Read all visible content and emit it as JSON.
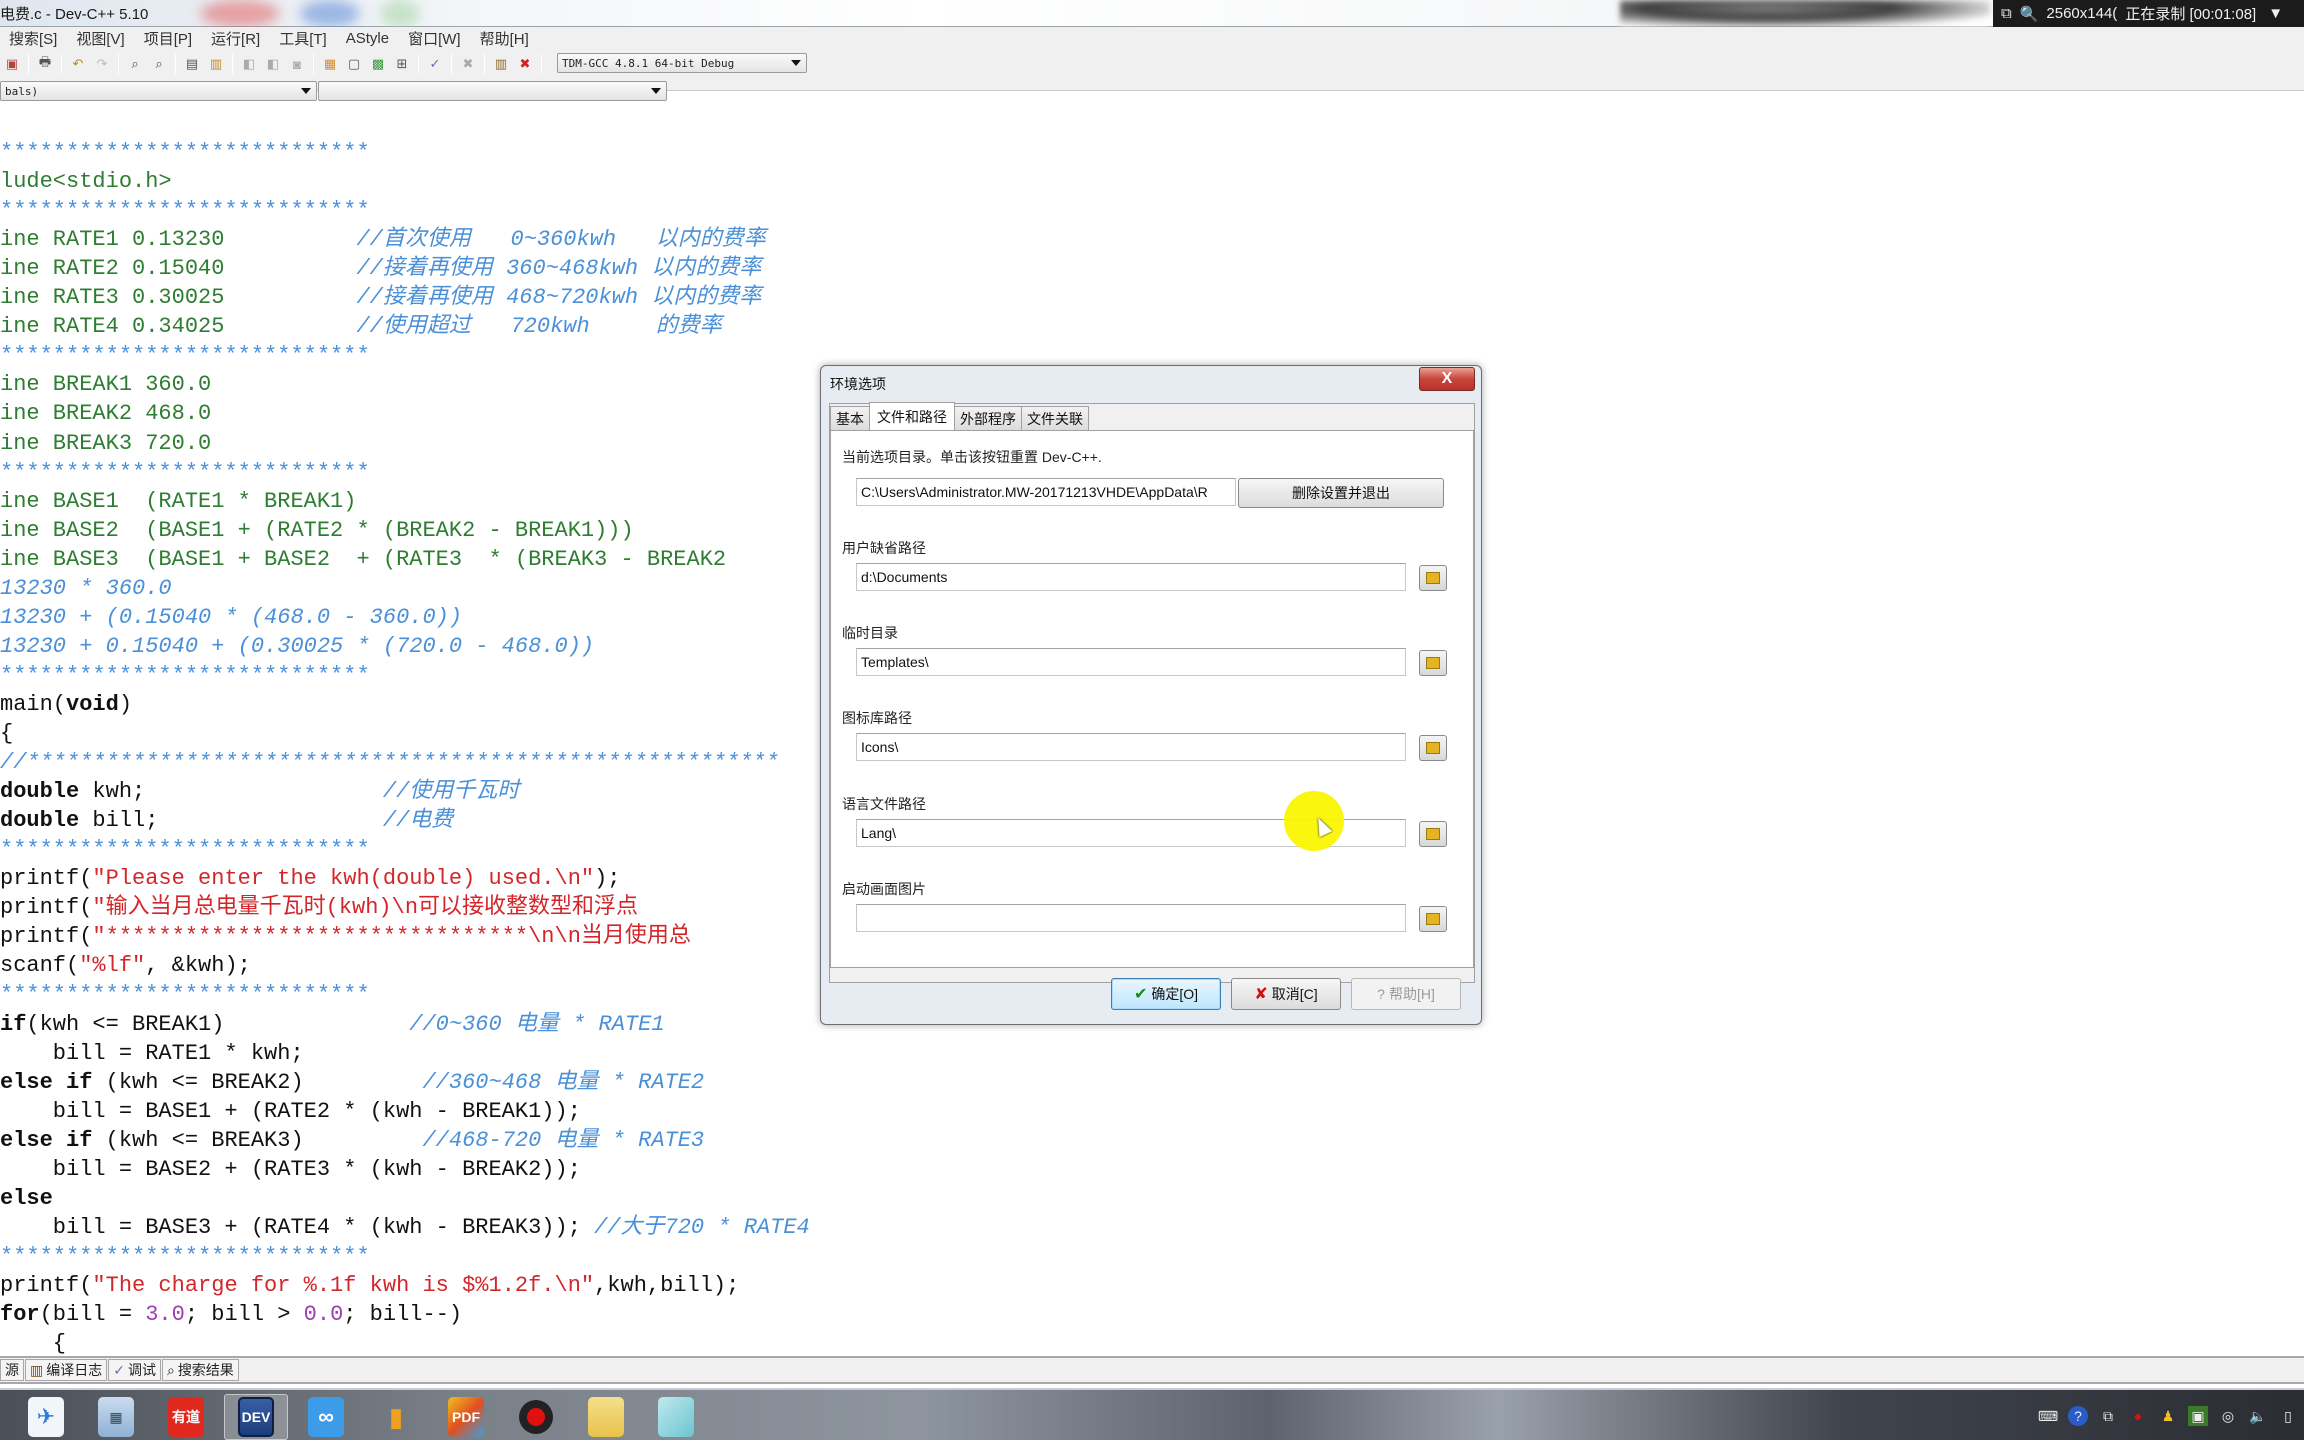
{
  "window": {
    "title": "电费.c - Dev-C++ 5.10"
  },
  "recorder": {
    "resolution": "2560x144(",
    "status": "正在录制 [00:01:08]"
  },
  "menu": [
    {
      "label": "搜索[S]"
    },
    {
      "label": "视图[V]"
    },
    {
      "label": "项目[P]"
    },
    {
      "label": "运行[R]"
    },
    {
      "label": "工具[T]"
    },
    {
      "label": "AStyle"
    },
    {
      "label": "窗口[W]"
    },
    {
      "label": "帮助[H]"
    }
  ],
  "toolbar": {
    "compiler_select": "TDM-GCC 4.8.1 64-bit Debug",
    "scope_select": "bals)",
    "symbol_select": "",
    "icons": [
      "close-file-icon",
      "print-icon",
      "undo-icon",
      "redo-icon",
      "find-icon",
      "replace-icon",
      "indent-icon",
      "unindent-icon",
      "bookmark-icon",
      "goto-icon",
      "toggle-icon",
      "new-project-icon",
      "window-icon",
      "class-icon",
      "grid-icon",
      "check-icon",
      "delete-icon",
      "chart-icon",
      "debug-icon"
    ]
  },
  "code_lines": [
    {
      "segments": [
        {
          "text": "****************************",
          "cls": "c-blue"
        }
      ]
    },
    {
      "segments": [
        {
          "text": "lude<stdio.h>",
          "cls": "c-green"
        }
      ]
    },
    {
      "segments": [
        {
          "text": "****************************",
          "cls": "c-blue"
        }
      ]
    },
    {
      "segments": [
        {
          "text": "ine RATE1 0.13230          ",
          "cls": "c-green"
        },
        {
          "text": "//首次使用   0~360kwh   以内的费率",
          "cls": "c-blue-i"
        }
      ]
    },
    {
      "segments": [
        {
          "text": "ine RATE2 0.15040          ",
          "cls": "c-green"
        },
        {
          "text": "//接着再使用 360~468kwh 以内的费率",
          "cls": "c-blue-i"
        }
      ]
    },
    {
      "segments": [
        {
          "text": "ine RATE3 0.30025          ",
          "cls": "c-green"
        },
        {
          "text": "//接着再使用 468~720kwh 以内的费率",
          "cls": "c-blue-i"
        }
      ]
    },
    {
      "segments": [
        {
          "text": "ine RATE4 0.34025          ",
          "cls": "c-green"
        },
        {
          "text": "//使用超过   720kwh     的费率",
          "cls": "c-blue-i"
        }
      ]
    },
    {
      "segments": [
        {
          "text": "****************************",
          "cls": "c-blue"
        }
      ]
    },
    {
      "segments": [
        {
          "text": "ine BREAK1 360.0",
          "cls": "c-green"
        }
      ]
    },
    {
      "segments": [
        {
          "text": "ine BREAK2 468.0",
          "cls": "c-green"
        }
      ]
    },
    {
      "segments": [
        {
          "text": "ine BREAK3 720.0",
          "cls": "c-green"
        }
      ]
    },
    {
      "segments": [
        {
          "text": "****************************",
          "cls": "c-blue"
        }
      ]
    },
    {
      "segments": [
        {
          "text": "ine BASE1  (RATE1 * BREAK1)",
          "cls": "c-green"
        }
      ]
    },
    {
      "segments": [
        {
          "text": "ine BASE2  (BASE1 + (RATE2 * (BREAK2 - BREAK1)))",
          "cls": "c-green"
        }
      ]
    },
    {
      "segments": [
        {
          "text": "ine BASE3  (BASE1 + BASE2  + (RATE3  * (BREAK3 - BREAK2",
          "cls": "c-green"
        }
      ]
    },
    {
      "segments": [
        {
          "text": "13230 * 360.0",
          "cls": "c-blue-i"
        }
      ]
    },
    {
      "segments": [
        {
          "text": "13230 + (0.15040 * (468.0 - 360.0))",
          "cls": "c-blue-i"
        }
      ]
    },
    {
      "segments": [
        {
          "text": "13230 + 0.15040 + (0.30025 * (720.0 - 468.0))",
          "cls": "c-blue-i"
        }
      ]
    },
    {
      "segments": [
        {
          "text": "****************************",
          "cls": "c-blue"
        }
      ]
    },
    {
      "segments": [
        {
          "text": "main(",
          "cls": "c-black"
        },
        {
          "text": "void",
          "cls": "c-bold"
        },
        {
          "text": ")",
          "cls": "c-black"
        }
      ]
    },
    {
      "segments": [
        {
          "text": "{",
          "cls": "c-black"
        }
      ]
    },
    {
      "segments": [
        {
          "text": "//*********************************************************",
          "cls": "c-blue-i"
        }
      ]
    },
    {
      "segments": [
        {
          "text": "double",
          "cls": "c-bold"
        },
        {
          "text": " kwh;                  ",
          "cls": "c-black"
        },
        {
          "text": "//使用千瓦时",
          "cls": "c-blue-i"
        }
      ]
    },
    {
      "segments": [
        {
          "text": "double",
          "cls": "c-bold"
        },
        {
          "text": " bill;                 ",
          "cls": "c-black"
        },
        {
          "text": "//电费",
          "cls": "c-blue-i"
        }
      ]
    },
    {
      "segments": [
        {
          "text": "****************************",
          "cls": "c-blue"
        }
      ]
    },
    {
      "segments": [
        {
          "text": "printf(",
          "cls": "c-black"
        },
        {
          "text": "\"Please enter the kwh(double) used.\\n\"",
          "cls": "c-red"
        },
        {
          "text": ");",
          "cls": "c-black"
        }
      ]
    },
    {
      "segments": [
        {
          "text": "printf(",
          "cls": "c-black"
        },
        {
          "text": "\"输入当月总电量千瓦时(kwh)\\n可以接收整数型和浮点",
          "cls": "c-red"
        }
      ]
    },
    {
      "segments": [
        {
          "text": "printf(",
          "cls": "c-black"
        },
        {
          "text": "\"********************************\\n\\n当月使用总",
          "cls": "c-red"
        }
      ]
    },
    {
      "segments": [
        {
          "text": "scanf(",
          "cls": "c-black"
        },
        {
          "text": "\"%lf\"",
          "cls": "c-red"
        },
        {
          "text": ", &kwh);",
          "cls": "c-black"
        }
      ]
    },
    {
      "segments": [
        {
          "text": "****************************",
          "cls": "c-blue"
        }
      ]
    },
    {
      "segments": [
        {
          "text": "if",
          "cls": "c-bold"
        },
        {
          "text": "(kwh <= BREAK1)              ",
          "cls": "c-black"
        },
        {
          "text": "//0~360 电量 * RATE1",
          "cls": "c-blue-i"
        }
      ]
    },
    {
      "segments": [
        {
          "text": "    bill = RATE1 * kwh;",
          "cls": "c-black"
        }
      ]
    },
    {
      "segments": [
        {
          "text": "else if",
          "cls": "c-bold"
        },
        {
          "text": " (kwh <= BREAK2)         ",
          "cls": "c-black"
        },
        {
          "text": "//360~468 电量 * RATE2",
          "cls": "c-blue-i"
        }
      ]
    },
    {
      "segments": [
        {
          "text": "    bill = BASE1 + (RATE2 * (kwh - BREAK1));",
          "cls": "c-black"
        }
      ]
    },
    {
      "segments": [
        {
          "text": "else if",
          "cls": "c-bold"
        },
        {
          "text": " (kwh <= BREAK3)         ",
          "cls": "c-black"
        },
        {
          "text": "//468-720 电量 * RATE3",
          "cls": "c-blue-i"
        }
      ]
    },
    {
      "segments": [
        {
          "text": "    bill = BASE2 + (RATE3 * (kwh - BREAK2));",
          "cls": "c-black"
        }
      ]
    },
    {
      "segments": [
        {
          "text": "else",
          "cls": "c-bold"
        }
      ]
    },
    {
      "segments": [
        {
          "text": "    bill = BASE3 + (RATE4 * (kwh - BREAK3)); ",
          "cls": "c-black"
        },
        {
          "text": "//大于720 * RATE4",
          "cls": "c-blue-i"
        }
      ]
    },
    {
      "segments": [
        {
          "text": "****************************",
          "cls": "c-blue"
        }
      ]
    },
    {
      "segments": [
        {
          "text": "printf(",
          "cls": "c-black"
        },
        {
          "text": "\"The charge for %.1f kwh is $%1.2f.\\n\"",
          "cls": "c-red"
        },
        {
          "text": ",kwh,bill);",
          "cls": "c-black"
        }
      ]
    },
    {
      "segments": [
        {
          "text": "for",
          "cls": "c-bold"
        },
        {
          "text": "(bill = ",
          "cls": "c-black"
        },
        {
          "text": "3.0",
          "cls": "c-purple"
        },
        {
          "text": "; bill > ",
          "cls": "c-black"
        },
        {
          "text": "0.0",
          "cls": "c-purple"
        },
        {
          "text": "; bill--)",
          "cls": "c-black"
        }
      ]
    },
    {
      "segments": [
        {
          "text": "    {",
          "cls": "c-black"
        }
      ]
    }
  ],
  "bottom_tabs": [
    {
      "label": "源",
      "icon": "resource-icon"
    },
    {
      "label": "编译日志",
      "icon": "chart-icon"
    },
    {
      "label": "调试",
      "icon": "check-icon"
    },
    {
      "label": "搜索结果",
      "icon": "search-icon"
    }
  ],
  "dialog": {
    "title": "环境选项",
    "close_label": "X",
    "tabs": [
      {
        "label": "基本",
        "active": false
      },
      {
        "label": "文件和路径",
        "active": true
      },
      {
        "label": "外部程序",
        "active": false
      },
      {
        "label": "文件关联",
        "active": false
      }
    ],
    "config_dir_label": "当前选项目录。单击该按钮重置 Dev-C++.",
    "config_dir_value": "C:\\Users\\Administrator.MW-20171213VHDE\\AppData\\R",
    "reset_button": "删除设置并退出",
    "fields": [
      {
        "label": "用户缺省路径",
        "value": "d:\\Documents"
      },
      {
        "label": "临时目录",
        "value": "Templates\\"
      },
      {
        "label": "图标库路径",
        "value": "Icons\\"
      },
      {
        "label": "语言文件路径",
        "value": "Lang\\"
      },
      {
        "label": "启动画面图片",
        "value": ""
      }
    ],
    "ok_button": "确定[O]",
    "cancel_button": "取消[C]",
    "help_button": "帮助[H]"
  },
  "taskbar": {
    "apps": [
      {
        "name": "feiq",
        "label": ""
      },
      {
        "name": "calculator",
        "label": ""
      },
      {
        "name": "youdao",
        "label": "有道"
      },
      {
        "name": "dev-cpp",
        "label": "DEV"
      },
      {
        "name": "baidu-cloud",
        "label": ""
      },
      {
        "name": "chart-app",
        "label": ""
      },
      {
        "name": "pdf",
        "label": "PDF"
      },
      {
        "name": "recorder",
        "label": ""
      },
      {
        "name": "file-explorer",
        "label": ""
      },
      {
        "name": "notepad",
        "label": ""
      }
    ]
  },
  "colors": {
    "code_green": "#2e7d32",
    "code_comment": "#4a90d9",
    "code_string": "#d3262b",
    "code_number": "#a03cb4",
    "cursor_highlight": "#fbf500"
  }
}
